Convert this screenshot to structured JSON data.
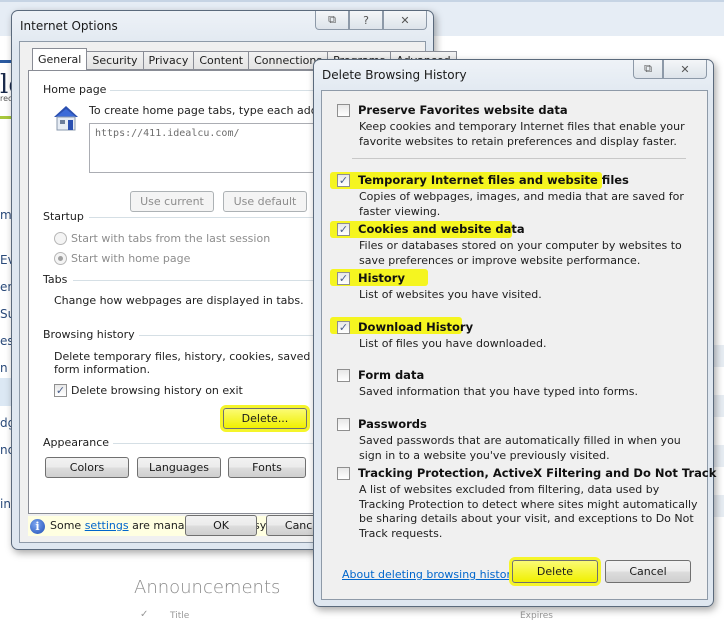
{
  "background_page": {
    "logo_partial": "le",
    "logo_sub_partial": "rec",
    "nav_partials": [
      "m",
      "Ev",
      "ent",
      "Su",
      "eso",
      "n T",
      "dg",
      "nd",
      "in"
    ],
    "announcements_heading": "Announcements",
    "table_headers": {
      "check": "✓",
      "title": "Title",
      "expires": "Expires"
    }
  },
  "internet_options": {
    "title": "Internet Options",
    "caption_buttons": [
      "context-help-menu",
      "help",
      "close"
    ],
    "caption_glyphs": {
      "menu": "⧉",
      "help": "?",
      "close": "✕"
    },
    "tabs": [
      {
        "label": "General",
        "active": true
      },
      {
        "label": "Security",
        "active": false
      },
      {
        "label": "Privacy",
        "active": false
      },
      {
        "label": "Content",
        "active": false
      },
      {
        "label": "Connections",
        "active": false
      },
      {
        "label": "Programs",
        "active": false
      },
      {
        "label": "Advanced",
        "active": false
      }
    ],
    "home_page": {
      "group_label": "Home page",
      "instruction": "To create home page tabs, type each address",
      "url_value": "https://411.idealcu.com/",
      "use_current_label": "Use current",
      "use_default_label": "Use default"
    },
    "startup": {
      "group_label": "Startup",
      "options": [
        {
          "label": "Start with tabs from the last session",
          "selected": false
        },
        {
          "label": "Start with home page",
          "selected": true
        }
      ]
    },
    "tabs_group": {
      "group_label": "Tabs",
      "description": "Change how webpages are displayed in tabs."
    },
    "browsing_history": {
      "group_label": "Browsing history",
      "description_line1": "Delete temporary files, history, cookies, saved passwo",
      "description_line2": "form information.",
      "delete_on_exit_label": "Delete browsing history on exit",
      "delete_on_exit_checked": true,
      "delete_button_label": "Delete..."
    },
    "appearance": {
      "group_label": "Appearance",
      "colors_label": "Colors",
      "languages_label": "Languages",
      "fonts_label": "Fonts"
    },
    "info_bar": {
      "prefix": "Some ",
      "link_text": "settings",
      "suffix": " are managed by your system admini"
    },
    "ok_label": "OK",
    "cancel_label": "Cance"
  },
  "delete_browsing_history": {
    "title": "Delete Browsing History",
    "caption_glyphs": {
      "menu": "⧉",
      "close": "✕"
    },
    "options": [
      {
        "title": "Preserve Favorites website data",
        "description": "Keep cookies and temporary Internet files that enable your favorite websites to retain preferences and display faster.",
        "checked": false,
        "highlighted": false
      },
      {
        "title": "Temporary Internet files and website files",
        "description": "Copies of webpages, images, and media that are saved for faster viewing.",
        "checked": true,
        "highlighted": true
      },
      {
        "title": "Cookies and website data",
        "description": "Files or databases stored on your computer by websites to save preferences or improve website performance.",
        "checked": true,
        "highlighted": true
      },
      {
        "title": "History",
        "description": "List of websites you have visited.",
        "checked": true,
        "highlighted": true
      },
      {
        "title": "Download History",
        "description": "List of files you have downloaded.",
        "checked": true,
        "highlighted": true
      },
      {
        "title": "Form data",
        "description": "Saved information that you have typed into forms.",
        "checked": false,
        "highlighted": false
      },
      {
        "title": "Passwords",
        "description": "Saved passwords that are automatically filled in when you sign in to a website you've previously visited.",
        "checked": false,
        "highlighted": false
      },
      {
        "title": "Tracking Protection, ActiveX Filtering and Do Not Track",
        "description": "A list of websites excluded from filtering, data used by Tracking Protection to detect where sites might automatically be sharing details about your visit, and exceptions to Do Not Track requests.",
        "checked": false,
        "highlighted": false
      }
    ],
    "about_link": "About deleting browsing history",
    "delete_label": "Delete",
    "cancel_label": "Cancel",
    "highlight_color": "#f5f520"
  }
}
